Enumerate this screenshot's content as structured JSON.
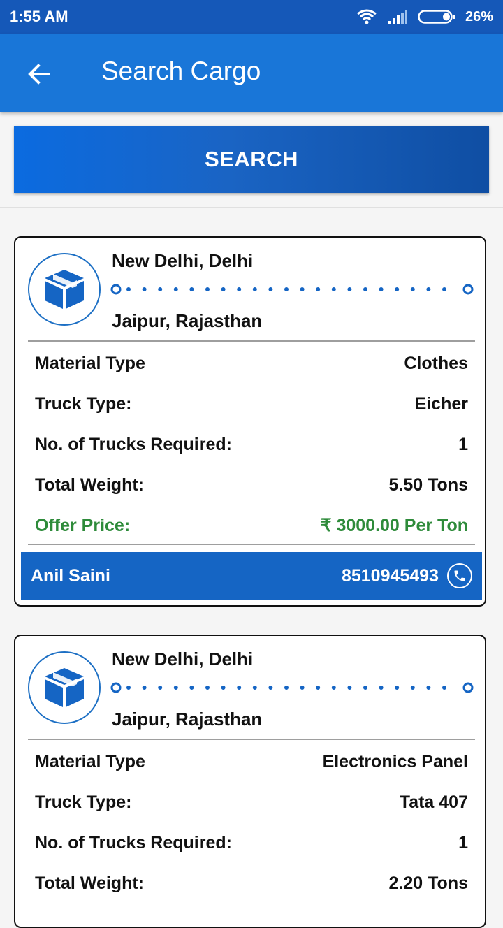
{
  "status_bar": {
    "time": "1:55 AM",
    "battery": "26%",
    "icons": [
      "wifi-icon",
      "signal-icon",
      "battery-icon"
    ]
  },
  "app_bar": {
    "title": "Search Cargo",
    "back_icon": "arrow-left-icon"
  },
  "search_button": {
    "label": "SEARCH"
  },
  "cards": [
    {
      "from": "New Delhi, Delhi",
      "to": "Jaipur, Rajasthan",
      "rows": [
        {
          "label": "Material Type",
          "value": "Clothes"
        },
        {
          "label": "Truck Type:",
          "value": "Eicher"
        },
        {
          "label": "No. of Trucks Required:",
          "value": "1"
        },
        {
          "label": "Total Weight:",
          "value": "5.50 Tons"
        }
      ],
      "offer": {
        "label": "Offer Price:",
        "value": "₹ 3000.00 Per Ton"
      },
      "contact": {
        "name": "Anil Saini",
        "phone": "8510945493"
      }
    },
    {
      "from": "New Delhi, Delhi",
      "to": "Jaipur, Rajasthan",
      "rows": [
        {
          "label": "Material Type",
          "value": "Electronics Panel"
        },
        {
          "label": "Truck Type:",
          "value": "Tata 407"
        },
        {
          "label": "No. of Trucks Required:",
          "value": "1"
        },
        {
          "label": "Total Weight:",
          "value": "2.20 Tons"
        }
      ]
    }
  ],
  "colors": {
    "primary": "#1976d8",
    "status_bar": "#1558b8",
    "contact_bar": "#1565c4",
    "offer_green": "#2e8b3a"
  }
}
